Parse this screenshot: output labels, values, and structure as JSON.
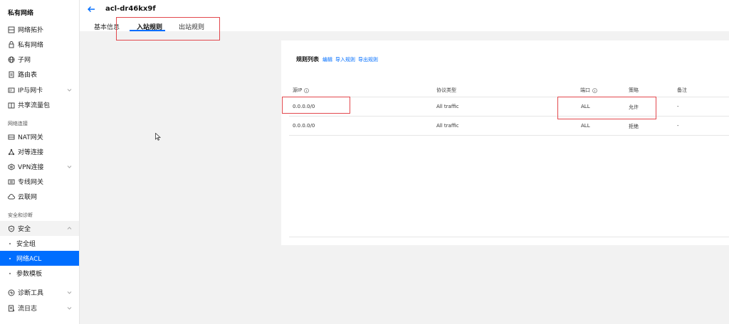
{
  "sidebar": {
    "title": "私有网络",
    "items": [
      {
        "label": "网络拓扑",
        "icon": "topology-icon"
      },
      {
        "label": "私有网络",
        "icon": "cloud-lock-icon"
      },
      {
        "label": "子网",
        "icon": "globe-icon"
      },
      {
        "label": "路由表",
        "icon": "document-icon"
      },
      {
        "label": "IP与网卡",
        "icon": "ip-icon"
      },
      {
        "label": "共享流量包",
        "icon": "package-icon"
      }
    ],
    "section_net": "网络连接",
    "net_items": [
      {
        "label": "NAT网关",
        "icon": "gateway-icon"
      },
      {
        "label": "对等连接",
        "icon": "peering-icon"
      },
      {
        "label": "VPN连接",
        "icon": "vpn-icon"
      },
      {
        "label": "专线网关",
        "icon": "line-gateway-icon"
      },
      {
        "label": "云联网",
        "icon": "cloud-network-icon"
      }
    ],
    "section_security": "安全和诊断",
    "security": {
      "label": "安全",
      "icon": "shield-icon"
    },
    "security_sub": [
      "安全组",
      "网络ACL",
      "参数模板"
    ],
    "tools": [
      {
        "label": "诊断工具",
        "icon": "diagnose-icon"
      },
      {
        "label": "流日志",
        "icon": "log-icon"
      }
    ]
  },
  "header": {
    "title": "acl-dr46kx9f",
    "tabs": [
      "基本信息",
      "入站规则",
      "出站规则"
    ]
  },
  "panel": {
    "title": "规则列表",
    "links": [
      "编辑",
      "导入规则",
      "导出规则"
    ],
    "columns": [
      "源IP",
      "协议类型",
      "端口",
      "策略",
      "备注"
    ],
    "rows": [
      [
        "0.0.0.0/0",
        "All traffic",
        "ALL",
        "允许",
        "-"
      ],
      [
        "0.0.0.0/0",
        "All traffic",
        "ALL",
        "拒绝",
        "-"
      ]
    ]
  },
  "colors": {
    "accent": "#006eff",
    "highlight": "#e2484d"
  }
}
